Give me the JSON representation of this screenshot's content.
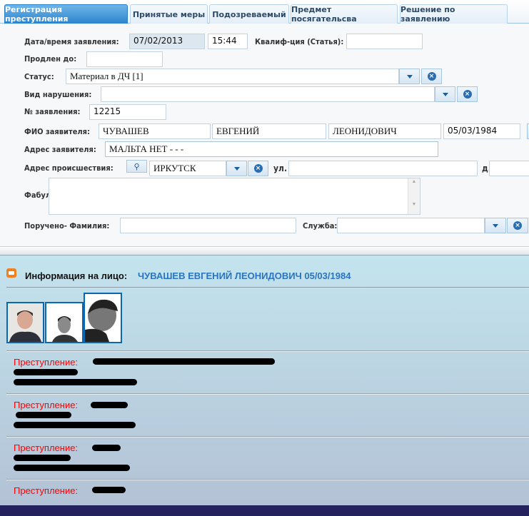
{
  "tabs": [
    {
      "label": "Регистрация преступления",
      "active": true
    },
    {
      "label": "Принятые меры",
      "active": false
    },
    {
      "label": "Подозреваемый",
      "active": false
    },
    {
      "label": "Предмет посягательсва",
      "active": false
    },
    {
      "label": "Решение по заявлению",
      "active": false
    }
  ],
  "form": {
    "date_label": "Дата/время заявления:",
    "date": "07/02/2013",
    "time": "15:44",
    "qualif_label": "Квалиф-ция (Статья):",
    "qualif": "",
    "extended_label": "Продлен до:",
    "extended": "",
    "status_label": "Статус:",
    "status": "Материал в ДЧ [1]",
    "violation_label": "Вид нарушения:",
    "violation": "",
    "number_label": "№ заявления:",
    "number": "12215",
    "fio_label": "ФИО заявителя:",
    "last_name": "ЧУВАШЕВ",
    "first_name": "ЕВГЕНИЙ",
    "middle_name": "ЛЕОНИДОВИЧ",
    "birth_date": "05/03/1984",
    "address_label": "Адрес заявителя:",
    "address": "МАЛЬТА НЕТ - - -",
    "incident_label": "Адрес происшествия:",
    "city": "ИРКУТСК",
    "street_label": "ул.",
    "street": "",
    "house_label": "д.",
    "house": "",
    "fabula_label": "Фабула:",
    "fabula": "",
    "assigned_label": "Поручено- Фамилия:",
    "assigned": "",
    "service_label": "Служба:",
    "service": ""
  },
  "info": {
    "label": "Информация на лицо:",
    "person": "ЧУВАШЕВ ЕВГЕНИЙ ЛЕОНИДОВИЧ 05/03/1984",
    "icon": "printer-icon"
  },
  "records": [
    {
      "label": "Преступление:"
    },
    {
      "label": "Преступление:"
    },
    {
      "label": "Преступление:"
    },
    {
      "label": "Преступление:"
    }
  ],
  "colors": {
    "accent": "#2c84cd",
    "person": "#2a74c0",
    "crime": "#ff0000",
    "footer": "#23225f"
  }
}
